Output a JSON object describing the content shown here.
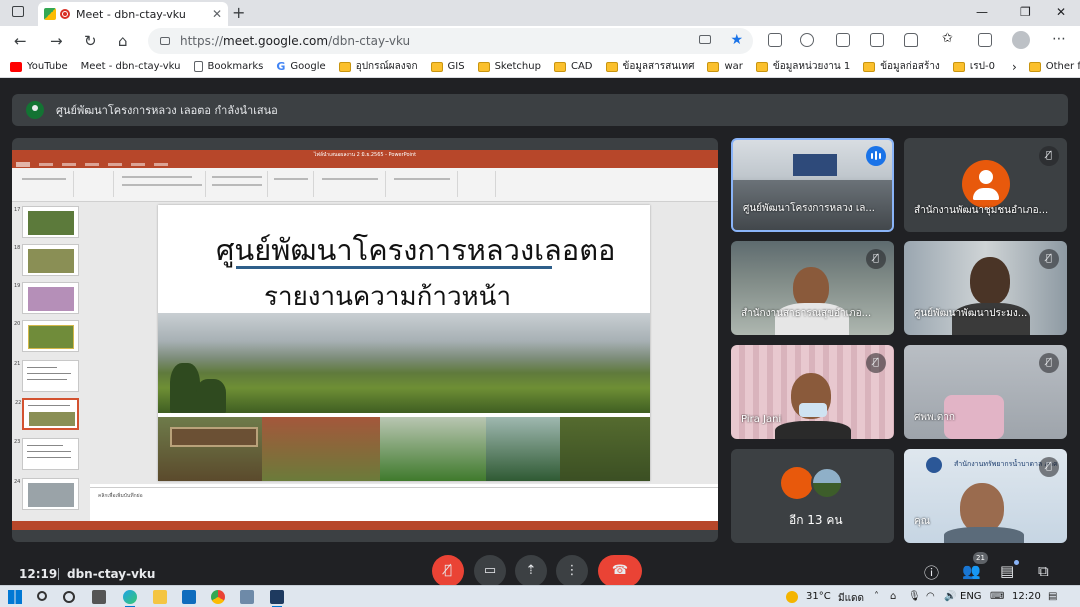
{
  "browser": {
    "tab_title": "Meet - dbn-ctay-vku",
    "url_prefix": "https://",
    "url_host": "meet.google.com",
    "url_path": "/dbn-ctay-vku",
    "bookmarks": [
      {
        "label": "YouTube",
        "icon": "youtube"
      },
      {
        "label": "Meet - dbn-ctay-vku",
        "icon": "meet"
      },
      {
        "label": "Bookmarks",
        "icon": "page"
      },
      {
        "label": "Google",
        "icon": "google"
      },
      {
        "label": "อุปกรณ์ผลงจก",
        "icon": "folder"
      },
      {
        "label": "GIS",
        "icon": "folder"
      },
      {
        "label": "Sketchup",
        "icon": "folder"
      },
      {
        "label": "CAD",
        "icon": "folder"
      },
      {
        "label": "ข้อมูลสารสนเทศ",
        "icon": "folder"
      },
      {
        "label": "war",
        "icon": "folder"
      },
      {
        "label": "ข้อมูลหน่วยงาน 1",
        "icon": "folder"
      },
      {
        "label": "ข้อมูลก่อสร้าง",
        "icon": "folder"
      },
      {
        "label": "เรป-0",
        "icon": "folder"
      }
    ],
    "other_favorites": "Other favorites"
  },
  "meet": {
    "presenting_text": "ศูนย์พัฒนาโครงการหลวง เลอตอ กำลังนำเสนอ",
    "slide": {
      "title_line1": "ศูนย์พัฒนาโครงการหลวงเลอตอ",
      "title_line2": "รายงานความก้าวหน้า",
      "ppt_window_title": "ไฟล์นำเสนอผลงาน 2 มิ.ย.2565 - PowerPoint",
      "thumb_numbers": [
        "17",
        "18",
        "19",
        "20",
        "21",
        "22",
        "23",
        "24"
      ],
      "notes_placeholder": "คลิกเพื่อเพิ่มบันทึกย่อ"
    },
    "tiles": [
      {
        "name": "ศูนย์พัฒนาโครงการหลวง เล...",
        "state": "speaking"
      },
      {
        "name": "สำนักงานพัฒนาชุมชนอำเภอ...",
        "state": "muted"
      },
      {
        "name": "สำนักงานสาธารณสุขอำเภอ...",
        "state": "muted"
      },
      {
        "name": "ศูนย์พัฒนาพัฒนาประมง...",
        "state": "muted"
      },
      {
        "name": "Pira Jani",
        "state": "muted"
      },
      {
        "name": "ศพพ.ตาก",
        "state": "muted"
      },
      {
        "name": "อีก 13 คน",
        "state": "more"
      },
      {
        "name": "คุณ",
        "state": "muted",
        "banner": "สำนักงานทรัพยากรน้ำบาดาล ภาค..."
      }
    ],
    "clock": "12:19",
    "meeting_code": "dbn-ctay-vku",
    "participants_count": "21"
  },
  "taskbar": {
    "temperature": "31°C",
    "weather": "มีแดด",
    "lang": "ENG",
    "time": "12:20"
  },
  "colors": {
    "accent": "#1a73e8",
    "hangup": "#ea4335",
    "ppt": "#b7472a",
    "meet_bg": "#202124"
  }
}
